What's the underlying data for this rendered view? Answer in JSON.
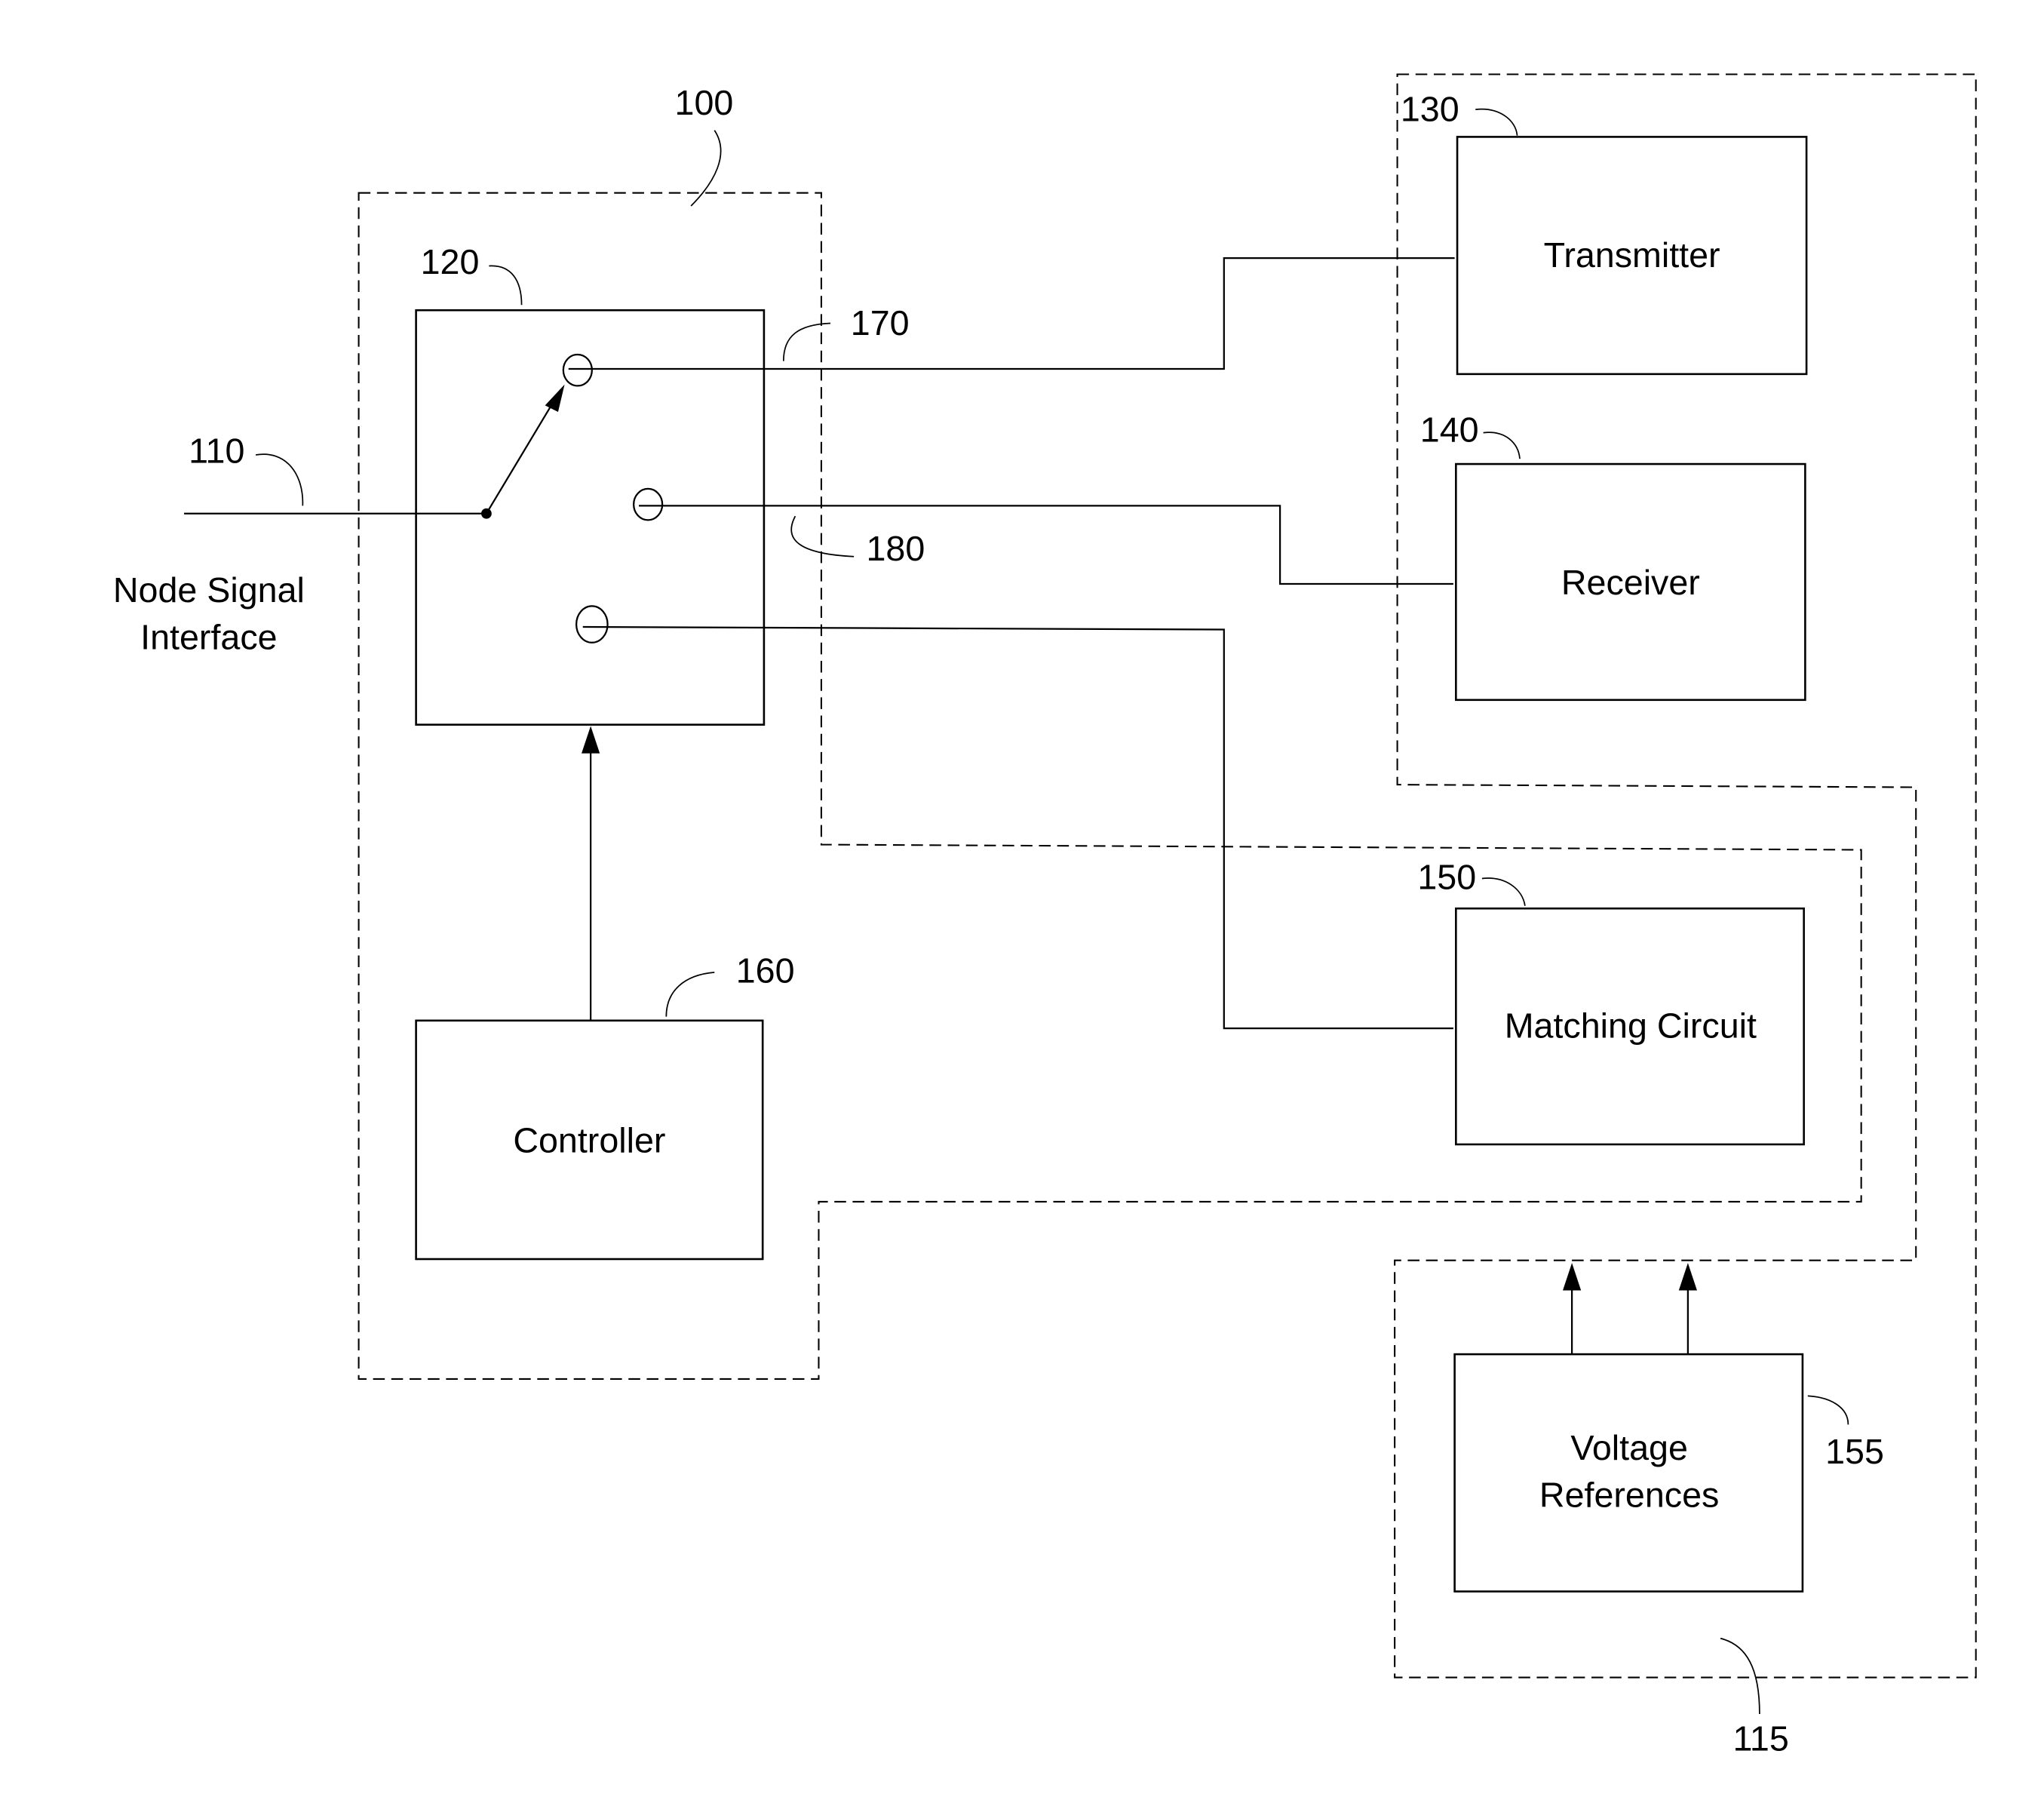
{
  "diagram": {
    "reference_numerals": {
      "switch_circuit_group": "100",
      "node_signal_line": "110",
      "transceiver_group": "115",
      "switch": "120",
      "transmitter": "130",
      "receiver": "140",
      "matching_circuit": "150",
      "voltage_references": "155",
      "controller": "160",
      "transmit_path": "170",
      "receive_path": "180"
    },
    "blocks": {
      "transmitter": "Transmitter",
      "receiver": "Receiver",
      "matching_circuit": "Matching Circuit",
      "controller": "Controller",
      "voltage_references_line1": "Voltage",
      "voltage_references_line2": "References"
    },
    "node_signal_interface_line1": "Node Signal",
    "node_signal_interface_line2": "Interface"
  }
}
